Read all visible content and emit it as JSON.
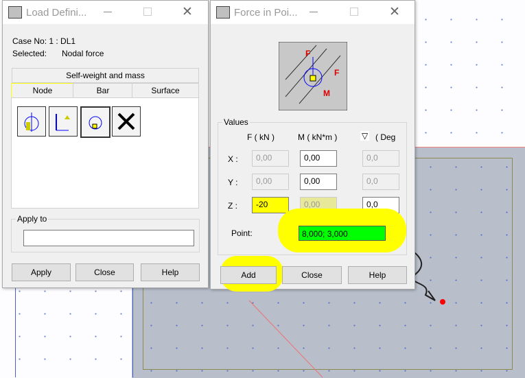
{
  "load_dialog": {
    "title": "Load Defini...",
    "case_no": "Case No: 1 : DL1",
    "selected_label": "Selected:",
    "selected_value": "Nodal force",
    "tab_selfweight": "Self-weight and mass",
    "tabs": [
      "Node",
      "Bar",
      "Surface"
    ],
    "apply_to_label": "Apply to",
    "apply_to_value": "",
    "buttons": {
      "apply": "Apply",
      "close": "Close",
      "help": "Help"
    }
  },
  "force_dialog": {
    "title": "Force in Poi...",
    "values_label": "Values",
    "col_f": "F  ( kN )",
    "col_m": "M  ( kN*m )",
    "col_deg": "( Deg",
    "rows": [
      {
        "label": "X :",
        "f": "0,00",
        "m": "0,00",
        "deg": "0,0"
      },
      {
        "label": "Y :",
        "f": "0,00",
        "m": "0,00",
        "deg": "0,0"
      },
      {
        "label": "Z :",
        "f": "-20",
        "m": "0,00",
        "deg": "0,0"
      }
    ],
    "point_label": "Point:",
    "point_value": "8,000; 3,000",
    "buttons": {
      "add": "Add",
      "close": "Close",
      "help": "Help"
    },
    "diagram_labels": {
      "f1": "F",
      "f2": "F",
      "m": "M"
    }
  },
  "colors": {
    "highlight": "#ffff00",
    "point_field": "#00ff00",
    "node_marker": "#ff0000"
  }
}
